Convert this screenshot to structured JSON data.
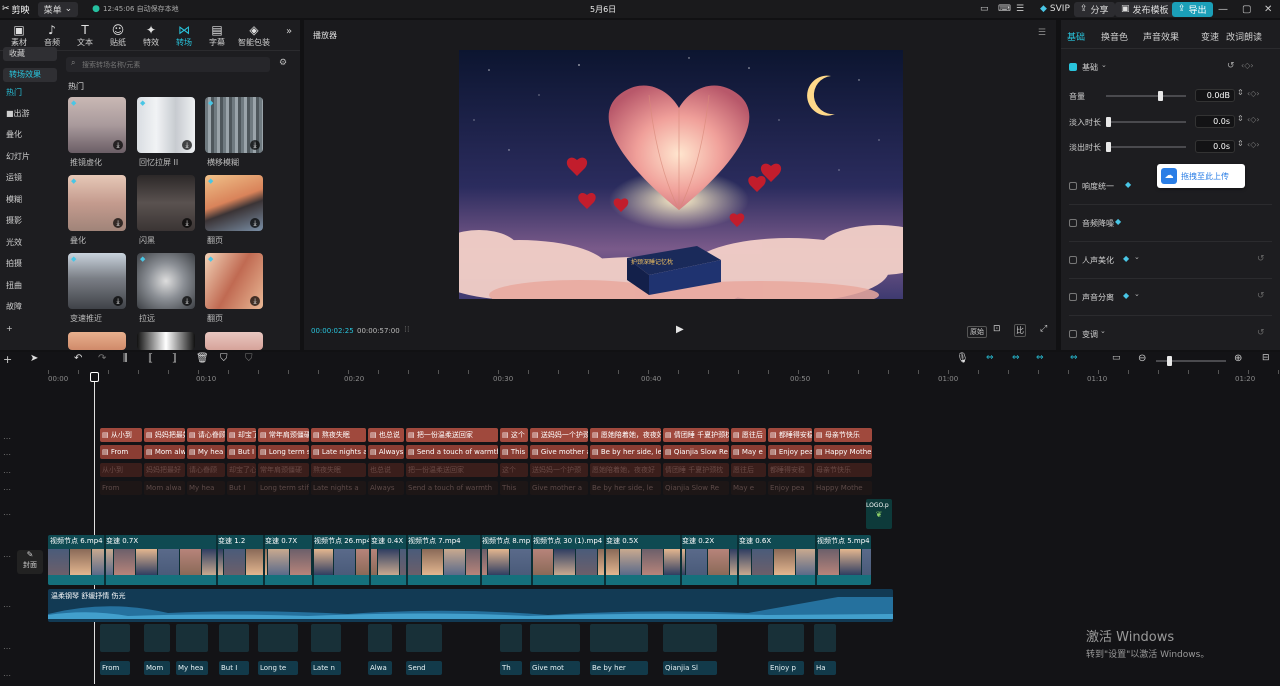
{
  "titlebar": {
    "app_name": "剪映",
    "menu_label": "菜单",
    "autosave": "12:45:06 自动保存本地",
    "project_title": "5月6日",
    "svip_label": "SVIP",
    "share_label": "分享",
    "publish_label": "发布模板",
    "export_label": "导出"
  },
  "toolbar": {
    "tools": [
      {
        "label": "素材",
        "icon": "media-icon"
      },
      {
        "label": "音频",
        "icon": "audio-icon"
      },
      {
        "label": "文本",
        "icon": "text-icon"
      },
      {
        "label": "贴纸",
        "icon": "sticker-icon"
      },
      {
        "label": "特效",
        "icon": "effects-icon"
      },
      {
        "label": "转场",
        "icon": "transition-icon"
      },
      {
        "label": "字幕",
        "icon": "caption-icon"
      },
      {
        "label": "智能包装",
        "icon": "smart-pack-icon"
      }
    ],
    "more": "»"
  },
  "sidebar": {
    "items": [
      "收藏",
      "转场效果",
      "热门",
      "■出游",
      "叠化",
      "幻灯片",
      "运镜",
      "模糊",
      "摄影",
      "光效",
      "拍摄",
      "扭曲",
      "故障",
      "+"
    ]
  },
  "search": {
    "placeholder": "搜索转场名称/元素"
  },
  "section_title": "热门",
  "transitions": [
    {
      "label": "推镜虚化"
    },
    {
      "label": "回忆拉屏 II"
    },
    {
      "label": "横移模糊"
    },
    {
      "label": "叠化"
    },
    {
      "label": "闪黑"
    },
    {
      "label": "翻页"
    },
    {
      "label": "变速推近"
    },
    {
      "label": "拉远"
    },
    {
      "label": "翻页"
    }
  ],
  "player": {
    "title": "播放器",
    "current_time": "00:00:02:25",
    "total_time": "00:00:57:00",
    "ratio_label": "原始",
    "image_box_text": "护颈深睡记忆枕"
  },
  "right": {
    "tabs": [
      "基础",
      "换音色",
      "声音效果",
      "变速",
      "改词朗读"
    ],
    "basic_label": "基础",
    "volume_label": "音量",
    "volume_value": "0.0dB",
    "fadein_label": "淡入时长",
    "fadein_value": "0.0s",
    "fadeout_label": "淡出时长",
    "fadeout_value": "0.0s",
    "loudness_label": "响度统一",
    "upload_label": "拖拽至此上传",
    "denoise_label": "音频降噪",
    "vocal_label": "人声美化",
    "separate_label": "声音分离",
    "pitch_label": "变调"
  },
  "timeline": {
    "ruler": [
      "00:00",
      "00:10",
      "00:20",
      "00:30",
      "00:40",
      "00:50",
      "01:00",
      "01:10",
      "01:20"
    ],
    "cover_label": "封面",
    "logo_label": "LOGO.p",
    "audio_label": "温柔钢琴 舒缓抒情 伤光",
    "subs_cn": [
      "从小到",
      "妈妈把最好",
      "请心眷顾",
      "却宝了心",
      "常年肩颈僵硬",
      "熬夜失眠",
      "也总说",
      "把一份温柔送回家",
      "这个",
      "送妈妈一个护颈",
      "愿她陪着她，夜夜好",
      "倩团睡 千夏护颈枕",
      "愿往后",
      "都睡得安稳",
      "母亲节快乐"
    ],
    "subs_en": [
      "From",
      "Mom alwa",
      "My hea",
      "But I",
      "Long term stiffne",
      "Late nights a",
      "Always",
      "Send a touch of warmth",
      "This",
      "Give mother a",
      "Be by her side, le",
      "Qianjia Slow Re",
      "May e",
      "Enjoy pea",
      "Happy Mothe"
    ],
    "video_clips": [
      {
        "label": "视频节点 6.mp4"
      },
      {
        "label": "变速 0.7X"
      },
      {
        "label": "变速 1.2"
      },
      {
        "label": "变速 0.7X"
      },
      {
        "label": "视频节点 26.mp4"
      },
      {
        "label": "变速 0.4X"
      },
      {
        "label": "视频节点 7.mp4"
      },
      {
        "label": "视频节点 8.mp"
      },
      {
        "label": "视频节点 30 (1).mp4"
      },
      {
        "label": "变速 0.5X"
      },
      {
        "label": "变速 0.2X"
      },
      {
        "label": "变速 0.6X"
      },
      {
        "label": "视频节点 5.mp4"
      }
    ],
    "audio_tts": [
      "From",
      "Mom",
      "My hea",
      "But I",
      "Long te",
      "Late n",
      "Alwa",
      "Send",
      "Th",
      "Give mot",
      "Be by her",
      "Qianjia Sl",
      "Enjoy p",
      "Ha"
    ]
  },
  "watermark": {
    "title": "激活 Windows",
    "subtitle": "转到\"设置\"以激活 Windows。"
  }
}
